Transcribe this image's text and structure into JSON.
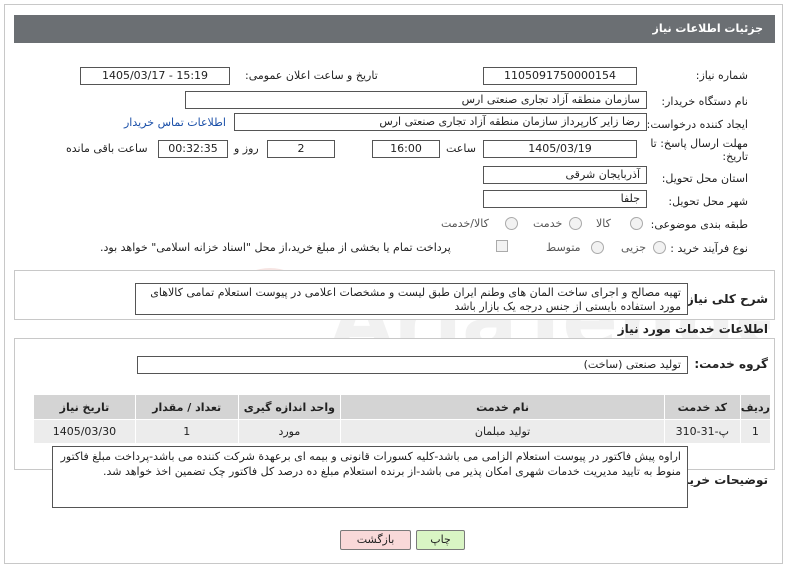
{
  "header": {
    "title": "جزئیات اطلاعات نیاز"
  },
  "fields": {
    "need_number_label": "شماره نیاز:",
    "need_number": "1105091750000154",
    "announce_label": "تاریخ و ساعت اعلان عمومی:",
    "announce_value": "1405/03/17 - 15:19",
    "buyer_org_label": "نام دستگاه خریدار:",
    "buyer_org": "سازمان منطقه آزاد تجاری صنعتی ارس",
    "creator_label": "ایجاد کننده درخواست:",
    "creator": "رضا زایر کارپرداز سازمان منطقه آزاد تجاری صنعتی ارس",
    "contact_link": "اطلاعات تماس خریدار",
    "deadline_label": "مهلت ارسال پاسخ: تا تاریخ:",
    "deadline_date": "1405/03/19",
    "time_label": "ساعت",
    "deadline_time": "16:00",
    "days_value": "2",
    "days_label": "روز و",
    "remaining_time": "00:32:35",
    "remaining_label": "ساعت باقی مانده",
    "province_label": "استان محل تحویل:",
    "province": "آذربایجان شرقی",
    "city_label": "شهر محل تحویل:",
    "city": "جلفا",
    "category_label": "طبقه بندی موضوعی:",
    "category_options": [
      "کالا",
      "خدمت",
      "کالا/خدمت"
    ],
    "process_label": "نوع فرآیند خرید :",
    "process_options": [
      "جزیی",
      "متوسط"
    ],
    "payment_note": "پرداخت تمام یا بخشی از مبلغ خرید،از محل \"اسناد خزانه اسلامی\" خواهد بود."
  },
  "description": {
    "label": "شرح کلی نیاز:",
    "text": "تهیه مصالح و اجرای ساخت المان های وطنم ایران طبق لیست و مشخصات اعلامی در پیوست استعلام تمامی کالاهای مورد استفاده بایستی از جنس درجه یک بازار باشد"
  },
  "services": {
    "title": "اطلاعات خدمات مورد نیاز",
    "group_label": "گروه خدمت:",
    "group_value": "تولید صنعتی (ساخت)",
    "columns": [
      "ردیف",
      "کد خدمت",
      "نام خدمت",
      "واحد اندازه گیری",
      "تعداد / مقدار",
      "تاریخ نیاز"
    ],
    "rows": [
      [
        "1",
        "پ-31-310",
        "تولید مبلمان",
        "مورد",
        "1",
        "1405/03/30"
      ]
    ]
  },
  "buyer_notes": {
    "label": "توضیحات خریدار:",
    "text": "اراوه پیش فاکتور در پیوست استعلام الزامی می باشد-کلیه کسورات قانونی و بیمه ای برعهدة شرکت کننده می باشد-پرداخت مبلغ فاکتور منوط به تایید مدیریت خدمات شهری امکان پذیر می باشد-از برنده استعلام مبلغ ده درصد کل فاکتور چک تضمین اخذ خواهد شد."
  },
  "buttons": {
    "print": "چاپ",
    "back": "بازگشت"
  },
  "colors": {
    "header_bg": "#6b6f73",
    "link": "#1a4fa8",
    "print_bg": "#d9f5c4",
    "back_bg": "#f9d9d9"
  },
  "watermark": {
    "text": "AriaTender.net"
  }
}
